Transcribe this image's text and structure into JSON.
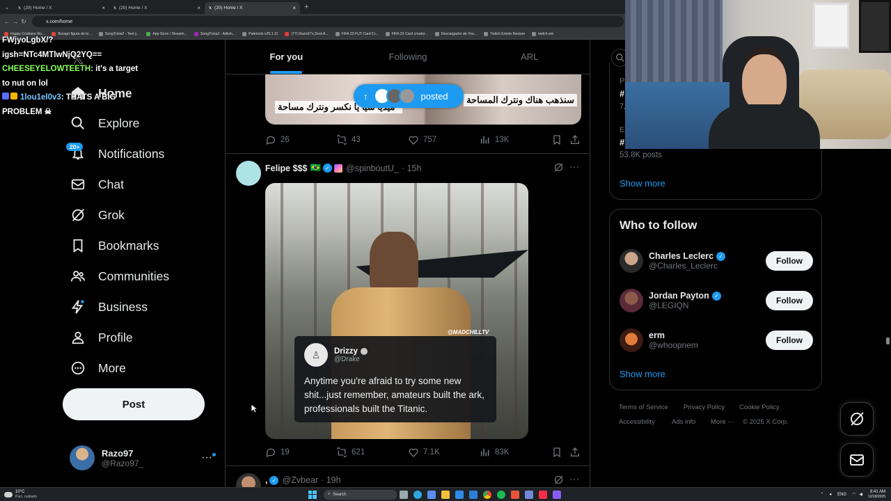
{
  "browser": {
    "tabs": [
      {
        "title": "(20) Home / X",
        "active": false
      },
      {
        "title": "(20) Home / X",
        "active": false
      },
      {
        "title": "(20) Home / X",
        "active": true
      }
    ],
    "new_tab_glyph": "+",
    "url": "x.com/home",
    "bookmarks": [
      {
        "label": "Happy Cristiano Ro...",
        "color": "#e0463a"
      },
      {
        "label": "Burago figura de to...",
        "color": "#e0463a"
      },
      {
        "label": "SongTrivia2 - Test y...",
        "color": "#8a8a8a"
      },
      {
        "label": "App Store / Streami...",
        "color": "#4caf50"
      },
      {
        "label": "SongTrivia2 - Adivin...",
        "color": "#9c27b0"
      },
      {
        "label": "Paletools v25.1.11",
        "color": "#8a8a8a"
      },
      {
        "label": "(77) Razo97's Zest-A...",
        "color": "#e53935"
      },
      {
        "label": "FIFA 23 FUT Card Cr...",
        "color": "#8a8a8a"
      },
      {
        "label": "FIFA 23 Card creator...",
        "color": "#8a8a8a"
      },
      {
        "label": "Descargador de You...",
        "color": "#8a8a8a"
      },
      {
        "label": "Twitch Emote Resizer",
        "color": "#8a8a8a"
      },
      {
        "label": "twitch em",
        "color": "#8a8a8a"
      }
    ]
  },
  "chat": {
    "lines": [
      {
        "user": "",
        "text": "FWjyoLgbX/?"
      },
      {
        "user": "",
        "text": "igsh=NTc4MTlwNjQ2YQ=="
      },
      {
        "user": "CHEESEYELOWTEETH",
        "text": ": it's a target"
      },
      {
        "user": "",
        "text": "to nut on lol"
      },
      {
        "user": "1lou1el0v3",
        "text": ": THATS A BIG"
      },
      {
        "user": "",
        "text": "PROBLEM"
      }
    ]
  },
  "nav": {
    "items": [
      {
        "key": "home",
        "label": "Home",
        "icon": "home-icon"
      },
      {
        "key": "explore",
        "label": "Explore",
        "icon": "search-icon"
      },
      {
        "key": "notifications",
        "label": "Notifications",
        "icon": "bell-icon"
      },
      {
        "key": "chat",
        "label": "Chat",
        "icon": "mail-icon"
      },
      {
        "key": "grok",
        "label": "Grok",
        "icon": "grok-icon"
      },
      {
        "key": "bookmarks",
        "label": "Bookmarks",
        "icon": "bookmark-icon"
      },
      {
        "key": "communities",
        "label": "Communities",
        "icon": "people-icon"
      },
      {
        "key": "business",
        "label": "Business",
        "icon": "lightning-icon"
      },
      {
        "key": "profile",
        "label": "Profile",
        "icon": "person-icon"
      },
      {
        "key": "more",
        "label": "More",
        "icon": "more-circle-icon"
      }
    ],
    "notifications_badge": "20+",
    "post_label": "Post",
    "user": {
      "name": "Razo97",
      "handle": "@Razo97_"
    }
  },
  "feed": {
    "tabs": [
      "For you",
      "Following",
      "ARL"
    ],
    "active_tab": "For you",
    "new_posts_pill": "posted",
    "top_post": {
      "image_text_left": "\"ميدياً شيا يا نكسر ونترك مساحة",
      "image_text_right": "سنذهب هناك ونترك المساحة",
      "replies": "26",
      "reposts": "43",
      "likes": "757",
      "views": "13K"
    },
    "post": {
      "author": "Felipe $$$",
      "emojis": "🇧🇷",
      "handle": "@spinboutU_",
      "time": "· 15h",
      "watermark": "@MADCHILLTV",
      "embedded": {
        "name": "Drizzy",
        "handle": "@Drake",
        "text": "Anytime you're afraid to try some new shit...just remember, amateurs built the ark, professionals built the Titanic."
      },
      "replies": "19",
      "reposts": "621",
      "likes": "7.1K",
      "views": "83K"
    },
    "next_post": {
      "author": ",",
      "handle": "@Zvbear",
      "time": "· 19h"
    }
  },
  "right": {
    "trends_partial": [
      {
        "line1": "P",
        "line2": "#",
        "line3": "7,"
      },
      {
        "line1": "E",
        "line2": "#"
      }
    ],
    "trend_count": "53.8K posts",
    "trends_show_more": "Show more",
    "who_to_follow_title": "Who to follow",
    "follow_label": "Follow",
    "suggestions": [
      {
        "name": "Charles Leclerc",
        "handle": "@Charles_Leclerc",
        "verified": true
      },
      {
        "name": "Jordan Payton",
        "handle": "@LEGIQN",
        "verified": true
      },
      {
        "name": "erm",
        "handle": "@whoopnem",
        "verified": false
      }
    ],
    "wtf_show_more": "Show more",
    "footer_links": [
      "Terms of Service",
      "Privacy Policy",
      "Cookie Policy",
      "Accessibility",
      "Ads info",
      "More ···",
      "© 2025 X Corp."
    ]
  },
  "taskbar": {
    "weather_temp": "10°C",
    "weather_desc": "Parc. nublado",
    "search_label": "Search",
    "lang": "ENG",
    "time": "8:41 AM",
    "date": "12/18/2025"
  },
  "colors": {
    "accent": "#1d9bf0",
    "background": "#000000",
    "border": "#2f3336",
    "muted": "#71767b"
  }
}
